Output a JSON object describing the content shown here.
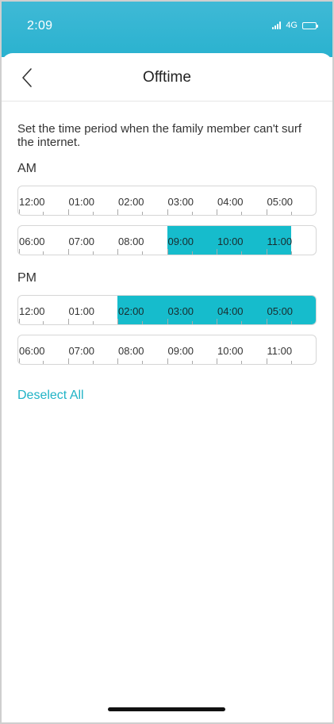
{
  "status": {
    "time": "2:09",
    "network": "4G"
  },
  "header": {
    "title": "Offtime"
  },
  "description": "Set the time period when the family member can't surf the internet.",
  "am": {
    "label": "AM",
    "rows": [
      {
        "times": [
          "12:00",
          "01:00",
          "02:00",
          "03:00",
          "04:00",
          "05:00"
        ],
        "selected_start": null,
        "selected_end": null
      },
      {
        "times": [
          "06:00",
          "07:00",
          "08:00",
          "09:00",
          "10:00",
          "11:00"
        ],
        "selected_start": "09:00",
        "selected_end": "11:30"
      }
    ]
  },
  "pm": {
    "label": "PM",
    "rows": [
      {
        "times": [
          "12:00",
          "01:00",
          "02:00",
          "03:00",
          "04:00",
          "05:00"
        ],
        "selected_start": "02:00",
        "selected_end": "06:00"
      },
      {
        "times": [
          "06:00",
          "07:00",
          "08:00",
          "09:00",
          "10:00",
          "11:00"
        ],
        "selected_start": null,
        "selected_end": null
      }
    ]
  },
  "actions": {
    "deselect_all": "Deselect All"
  },
  "colors": {
    "accent": "#16bccc",
    "header": "#2ab2cf",
    "link": "#1fb3c6"
  }
}
